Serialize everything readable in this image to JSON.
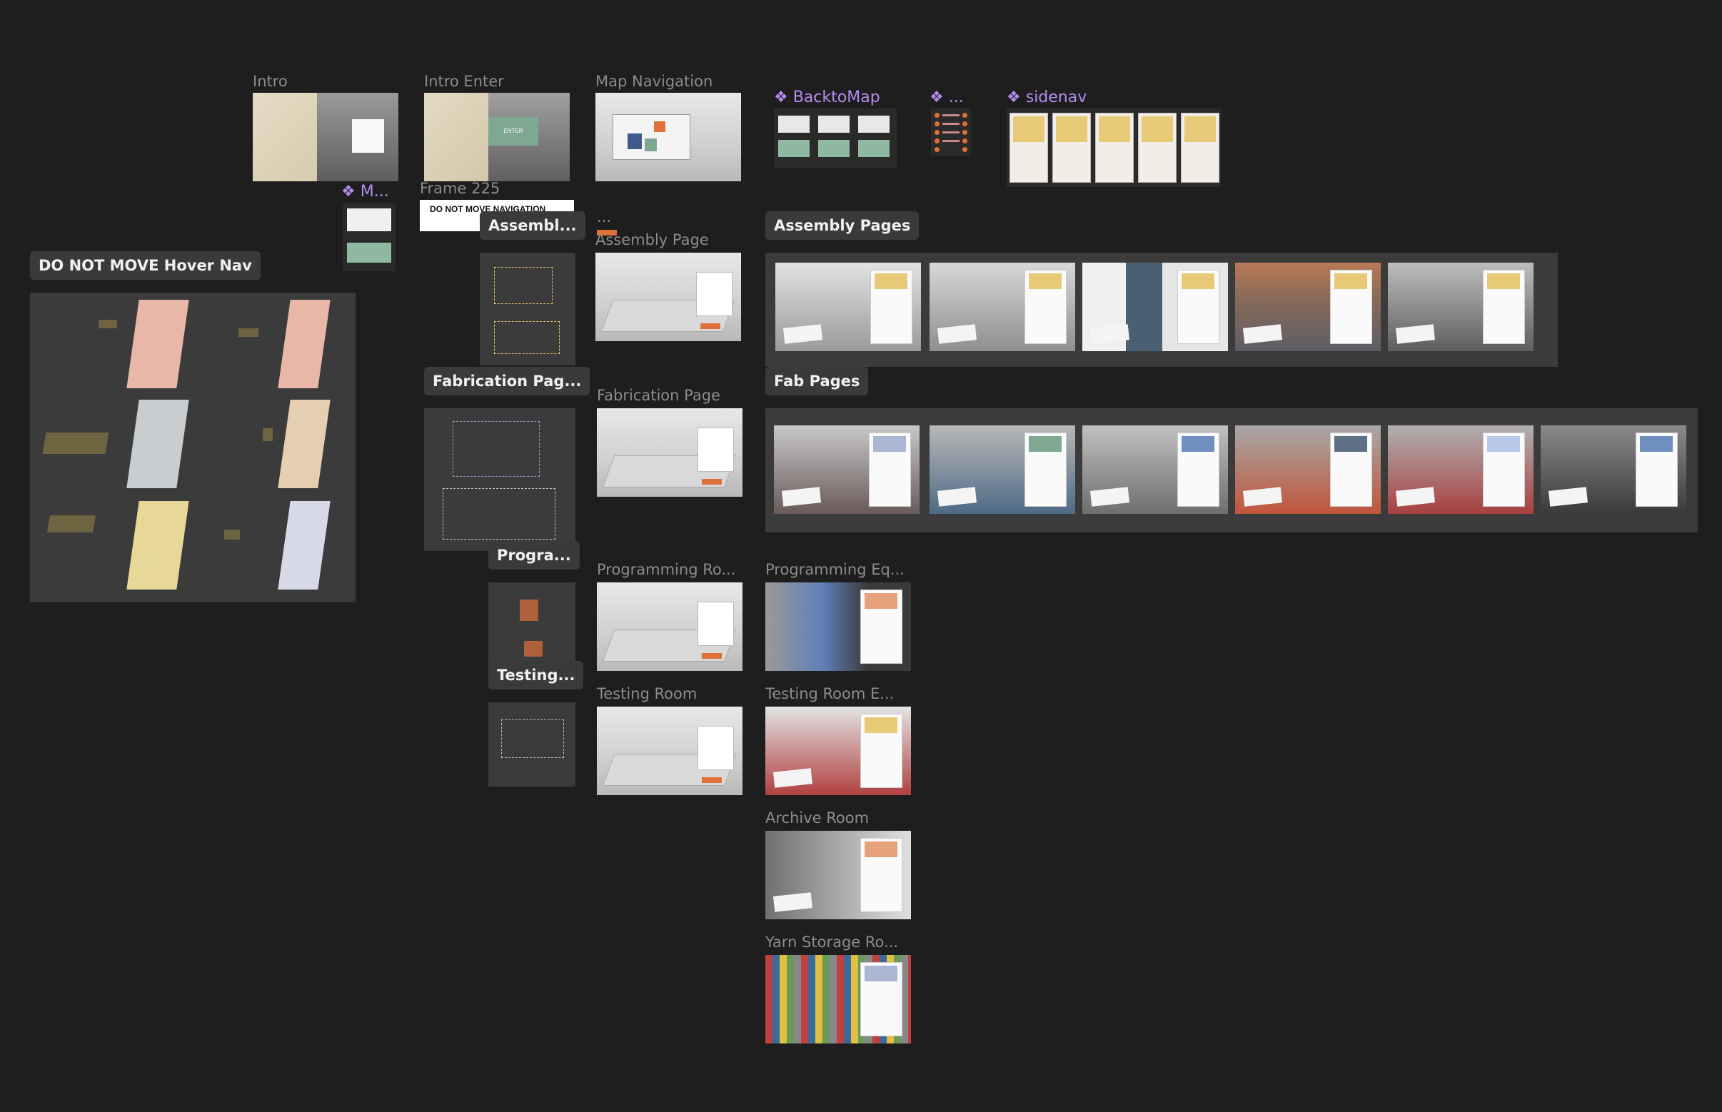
{
  "frames": {
    "intro": "Intro",
    "intro_enter": "Intro Enter",
    "intro_enter_button": "ENTER",
    "map_navigation": "Map Navigation",
    "frame_225": "Frame 225",
    "frame_225_text": "DO NOT MOVE NAVIGATION",
    "assembly_page": "Assembly Page",
    "fabrication_page": "Fabrication Page",
    "programming_room": "Programming Ro...",
    "programming_equipment": "Programming Eq...",
    "testing_room": "Testing Room",
    "testing_room_equipment": "Testing Room E...",
    "archive_room": "Archive Room",
    "yarn_storage_room": "Yarn Storage Ro...",
    "ellipsis": "..."
  },
  "components": {
    "m": "M...",
    "backtomap": "BacktoMap",
    "dots": "...",
    "sidenav": "sidenav"
  },
  "sections": {
    "hover_nav": "DO NOT MOVE Hover Nav",
    "assembly_short": "Assembl...",
    "assembly_pages": "Assembly Pages",
    "fabrication_short": "Fabrication Pag...",
    "fab_pages": "Fab Pages",
    "programming_short": "Progra...",
    "testing_short": "Testing..."
  },
  "colors": {
    "canvas": "#1e1e1e",
    "section_bg": "#3b3b3b",
    "component_purple": "#b48cf0",
    "accent_orange": "#e0703a"
  }
}
